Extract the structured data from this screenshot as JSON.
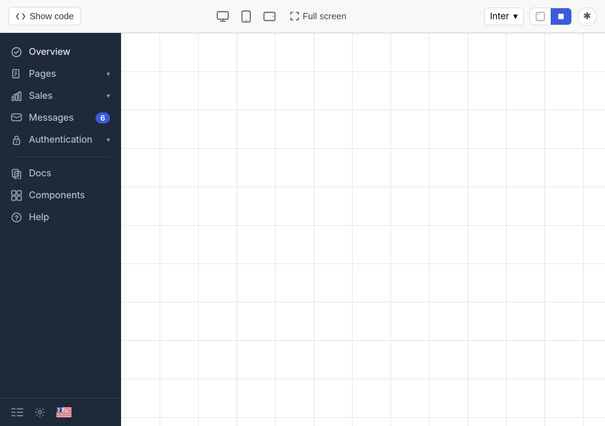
{
  "toolbar": {
    "show_code_label": "Show code",
    "full_screen_label": "Full screen",
    "font_selector_value": "Inter",
    "font_selector_chevron": "▾",
    "theme_light_label": "☀",
    "theme_dark_label": "■",
    "asterisk_label": "✱",
    "device_icons": [
      "monitor",
      "tablet-portrait",
      "tablet-landscape"
    ]
  },
  "sidebar": {
    "nav_items": [
      {
        "id": "overview",
        "label": "Overview",
        "icon": "overview",
        "badge": null,
        "chevron": false
      },
      {
        "id": "pages",
        "label": "Pages",
        "icon": "pages",
        "badge": null,
        "chevron": true
      },
      {
        "id": "sales",
        "label": "Sales",
        "icon": "sales",
        "badge": null,
        "chevron": true
      },
      {
        "id": "messages",
        "label": "Messages",
        "icon": "messages",
        "badge": "6",
        "chevron": false
      },
      {
        "id": "authentication",
        "label": "Authentication",
        "icon": "auth",
        "badge": null,
        "chevron": true
      }
    ],
    "secondary_items": [
      {
        "id": "docs",
        "label": "Docs",
        "icon": "docs"
      },
      {
        "id": "components",
        "label": "Components",
        "icon": "components"
      },
      {
        "id": "help",
        "label": "Help",
        "icon": "help"
      }
    ],
    "bottom": {
      "bars_icon": "bars",
      "settings_icon": "gear",
      "flag_icon": "us-flag"
    }
  },
  "colors": {
    "sidebar_bg": "#1e2a3a",
    "sidebar_text": "#c8d0dc",
    "accent": "#3b5bdb",
    "content_bg": "#ffffff",
    "grid_line": "#e8e8e8",
    "toolbar_bg": "#f8f8f8"
  }
}
